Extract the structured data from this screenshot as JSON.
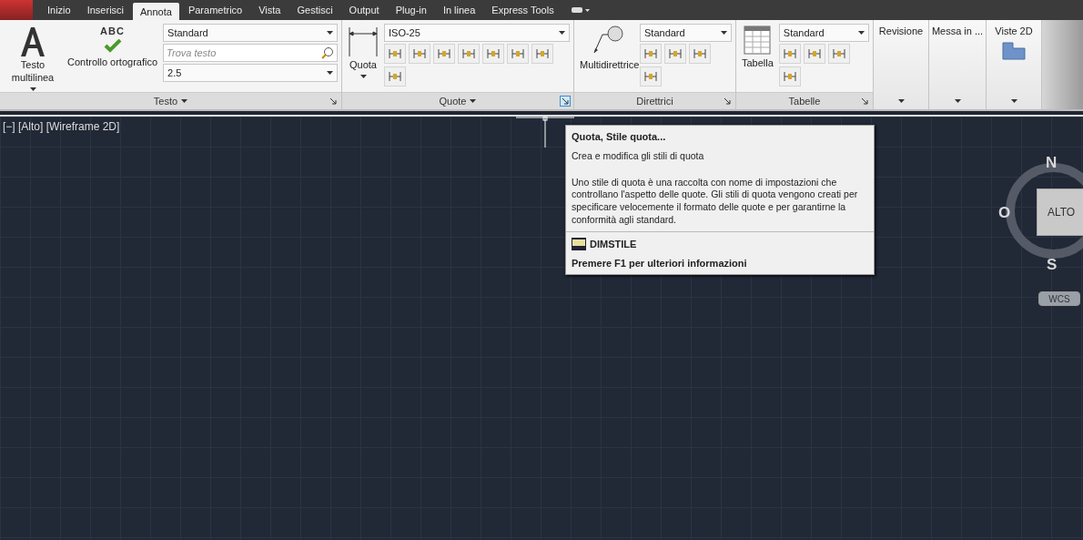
{
  "tabs": [
    {
      "label": "Inizio",
      "selected": false
    },
    {
      "label": "Inserisci",
      "selected": false
    },
    {
      "label": "Annota",
      "selected": true
    },
    {
      "label": "Parametrico",
      "selected": false
    },
    {
      "label": "Vista",
      "selected": false
    },
    {
      "label": "Gestisci",
      "selected": false
    },
    {
      "label": "Output",
      "selected": false
    },
    {
      "label": "Plug-in",
      "selected": false
    },
    {
      "label": "In linea",
      "selected": false
    },
    {
      "label": "Express Tools",
      "selected": false
    }
  ],
  "panels": [
    {
      "kind": "full",
      "title": "Testo",
      "title_caret": true,
      "launcher_hovered": false,
      "large_buttons": [
        {
          "label": "Testo multilinea",
          "caret": true
        },
        {
          "label": "Controllo ortografico",
          "icon_text": "ABC",
          "caret": false
        }
      ],
      "fields": [
        {
          "kind": "dropdown",
          "value": "Standard"
        },
        {
          "kind": "search",
          "placeholder": "Trova testo"
        },
        {
          "kind": "dropdown",
          "value": "2.5"
        }
      ]
    },
    {
      "kind": "full",
      "title": "Quote",
      "title_caret": true,
      "launcher_hovered": true,
      "large_buttons": [
        {
          "label": "Quota",
          "caret": true
        }
      ],
      "fields": [
        {
          "kind": "dropdown",
          "value": "ISO-25"
        }
      ]
    },
    {
      "kind": "full",
      "title": "Direttrici",
      "title_caret": false,
      "launcher_hovered": false,
      "large_buttons": [
        {
          "label": "Multidirettrice",
          "caret": false
        }
      ],
      "fields": [
        {
          "kind": "dropdown",
          "value": "Standard"
        }
      ]
    },
    {
      "kind": "full",
      "title": "Tabelle",
      "title_caret": false,
      "launcher_hovered": false,
      "large_buttons": [
        {
          "label": "Tabella",
          "caret": false
        }
      ],
      "fields": [
        {
          "kind": "dropdown",
          "value": "Standard"
        }
      ]
    },
    {
      "kind": "collapsed",
      "title": "Revisione"
    },
    {
      "kind": "collapsed",
      "title": "Messa in ..."
    },
    {
      "kind": "collapsed",
      "title": "Viste 2D"
    }
  ],
  "viewport": {
    "label": "[−] [Alto] [Wireframe 2D]"
  },
  "tooltip": {
    "title": "Quota, Stile quota...",
    "subtitle": "Crea e modifica gli stili di quota",
    "description": "Uno stile di quota è una raccolta con nome di impostazioni che controllano l'aspetto delle quote. Gli stili di quota vengono creati per specificare velocemente il formato delle quote e per garantirne la conformità agli standard.",
    "command": "DIMSTILE",
    "help": "Premere F1 per ulteriori informazioni"
  },
  "viewcube": {
    "north": "N",
    "west": "O",
    "south": "S",
    "face": "ALTO",
    "ucs": "WCS"
  }
}
